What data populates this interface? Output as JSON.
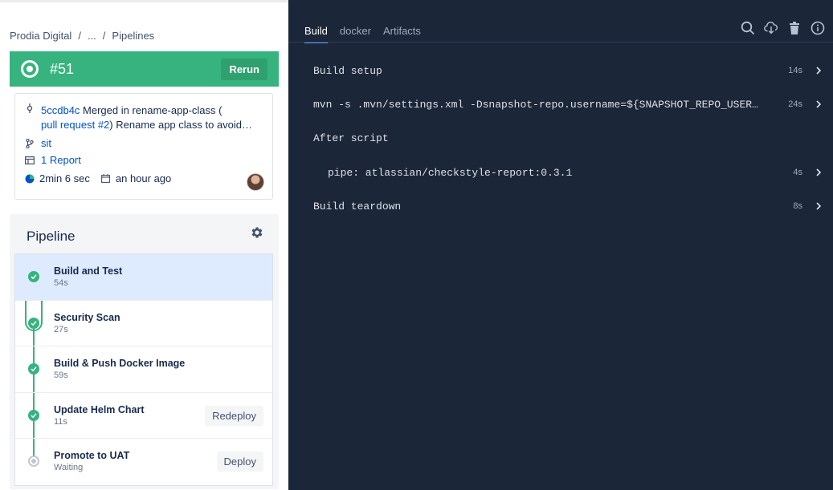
{
  "breadcrumb": {
    "items": [
      "Prodia Digital",
      "...",
      "Pipelines"
    ],
    "separator": "/"
  },
  "run": {
    "number": "#51",
    "status_color": "#36b37e",
    "rerun_label": "Rerun"
  },
  "commit": {
    "hash": "5ccdb4c",
    "message_pre": "Merged in rename-app-class (",
    "pr_link": "pull request #2",
    "message_post": ") Rename app class to avoid…",
    "branch": "sit",
    "reports": "1 Report",
    "duration": "2min 6 sec",
    "time_ago": "an hour ago"
  },
  "pipeline": {
    "title": "Pipeline",
    "steps": [
      {
        "name": "Build and Test",
        "time": "54s",
        "status": "success"
      },
      {
        "name": "Security Scan",
        "time": "27s",
        "status": "success"
      },
      {
        "name": "Build & Push Docker Image",
        "time": "59s",
        "status": "success"
      },
      {
        "name": "Update Helm Chart",
        "time": "11s",
        "status": "success",
        "button": "Redeploy"
      },
      {
        "name": "Promote to UAT",
        "time": "Waiting",
        "status": "pending",
        "button": "Deploy"
      }
    ]
  },
  "log_view": {
    "tabs": [
      "Build",
      "docker",
      "Artifacts"
    ],
    "active_tab": "Build",
    "icons": [
      "search-icon",
      "download-icon",
      "trash-icon",
      "info-icon"
    ],
    "rows": [
      {
        "text": "Build setup",
        "duration": "14s"
      },
      {
        "text": "mvn -s .mvn/settings.xml -Dsnapshot-repo.username=${SNAPSHOT_REPO_USERNA…",
        "duration": "24s"
      },
      {
        "text": "After script",
        "duration": ""
      },
      {
        "text": "pipe: atlassian/checkstyle-report:0.3.1",
        "duration": "4s"
      },
      {
        "text": "Build teardown",
        "duration": "8s"
      }
    ]
  }
}
